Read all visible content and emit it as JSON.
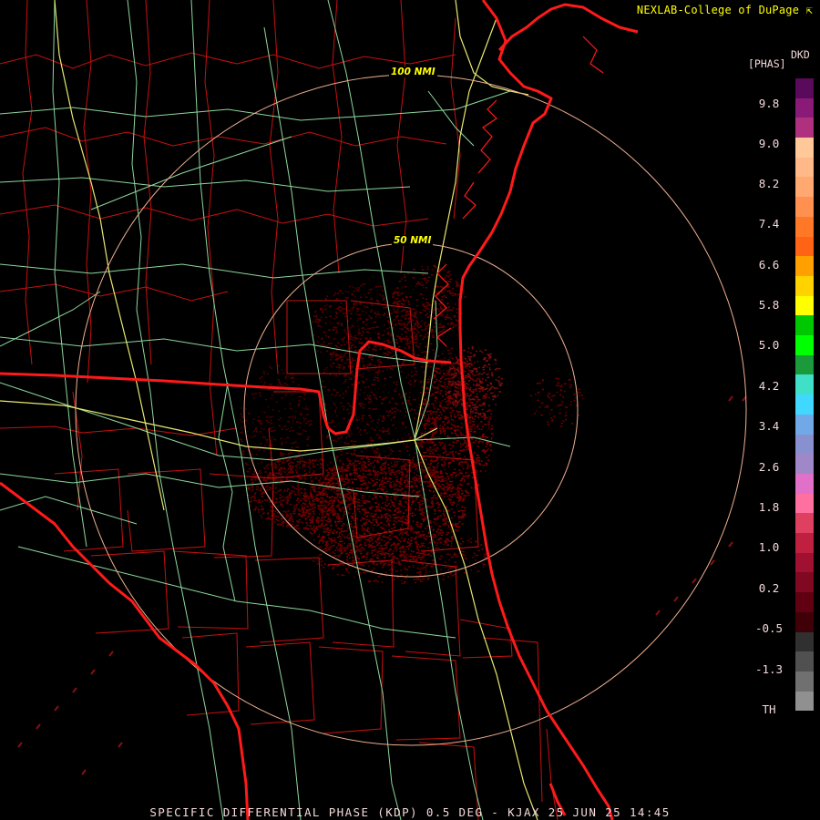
{
  "credit": "NEXLAB-College of DuPage",
  "product_title": "SPECIFIC DIFFERENTIAL PHASE (KDP) 0.5 DEG - KJAX 25 JUN 25 14:45",
  "legend": {
    "units": "[PHAS]",
    "product_code": "DKD",
    "ticks": [
      "9.8",
      "9.0",
      "8.2",
      "7.4",
      "6.6",
      "5.8",
      "5.0",
      "4.2",
      "3.4",
      "2.6",
      "1.8",
      "1.0",
      "0.2",
      "-0.5",
      "-1.3",
      "TH"
    ],
    "colors": [
      "#5a0a5a",
      "#8a1a78",
      "#b03080",
      "#ffc898",
      "#ffb888",
      "#ffa870",
      "#ff9050",
      "#ff7828",
      "#ff6414",
      "#ffa000",
      "#ffd200",
      "#ffff00",
      "#00c800",
      "#00ff00",
      "#1a9a3a",
      "#40e0c8",
      "#40d8ff",
      "#70a8e8",
      "#8890d0",
      "#a088c8",
      "#e070c8",
      "#ff70a0",
      "#e04060",
      "#c02040",
      "#a01030",
      "#800820",
      "#600010",
      "#400008",
      "#303030",
      "#505050",
      "#707070",
      "#909090",
      "#000000"
    ]
  },
  "range_rings": [
    "50 NMI",
    "100 NMI"
  ],
  "map_colors": {
    "coast": "#ff1a1a",
    "county": "#c81010",
    "highway": "#8cd89c",
    "interstate": "#e8e870",
    "ring": "#f0b090",
    "echo": "#7a0000"
  },
  "icons": [
    "credit-arrow-icon"
  ]
}
